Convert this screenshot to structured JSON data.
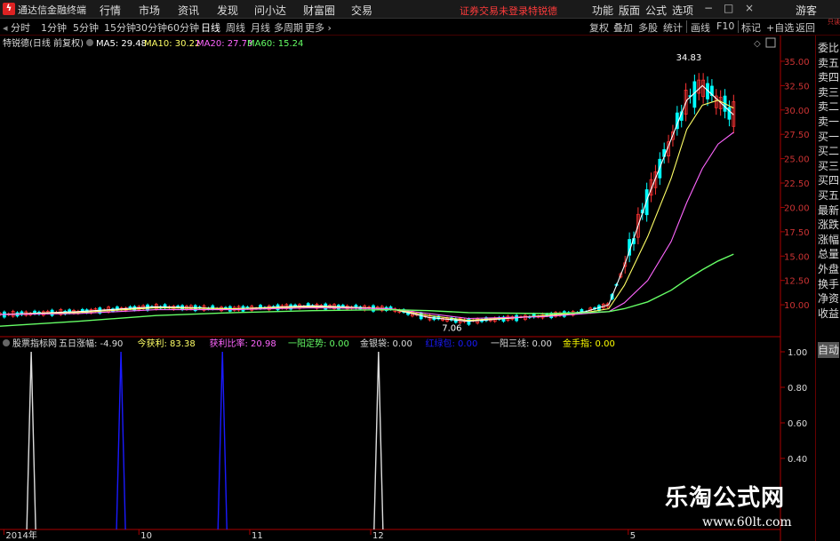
{
  "app": {
    "title": "通达信金融终端",
    "logo": "lightning-logo"
  },
  "menu": [
    "行情",
    "市场",
    "资讯",
    "发现",
    "问小达",
    "财富圈",
    "交易"
  ],
  "notice": "证券交易未登录",
  "stock_name": "特锐德",
  "right_menu": [
    "功能",
    "版面",
    "公式",
    "选项"
  ],
  "window_buttons": [
    "−",
    "□",
    "×"
  ],
  "guest": "游客",
  "periods": [
    "分时",
    "1分钟",
    "5分钟",
    "15分钟",
    "30分钟",
    "60分钟",
    "日线",
    "周线",
    "月线",
    "多周期",
    "更多"
  ],
  "active_period": "日线",
  "toolbar_right": [
    "复权",
    "叠加",
    "多股",
    "统计",
    "画线",
    "F10",
    "标记",
    "+自选",
    "返回"
  ],
  "main_header": {
    "name": "特锐德(日线 前复权)",
    "ma5": "MA5: 29.48",
    "ma10": "MA10: 30.22",
    "ma20": "MA20: 27.73",
    "ma60": "MA60: 15.24"
  },
  "colors": {
    "up": "#ff3333",
    "down": "#00ffff",
    "ma5": "#ffffff",
    "ma10": "#ffff66",
    "ma20": "#ff66ff",
    "ma60": "#66ff66",
    "axis": "#aa0000",
    "ind_white": "#dddddd",
    "ind_blue": "#1a1aff"
  },
  "indicator_header": {
    "name": "股票指标网",
    "items": [
      {
        "label": "五日涨幅: -4.90",
        "color": "#dddddd"
      },
      {
        "label": "今获利: 83.38",
        "color": "#ffff66"
      },
      {
        "label": "获利比率: 20.98",
        "color": "#ff66ff"
      },
      {
        "label": "一阳定势: 0.00",
        "color": "#66ff66"
      },
      {
        "label": "金银袋: 0.00",
        "color": "#dddddd"
      },
      {
        "label": "红绿包: 0.00",
        "color": "#1a1aff"
      },
      {
        "label": "一阳三线: 0.00",
        "color": "#dddddd"
      },
      {
        "label": "金手指: 0.00",
        "color": "#ffff00"
      }
    ]
  },
  "sidebar": [
    "委比",
    "卖五",
    "卖四",
    "卖三",
    "卖二",
    "卖一",
    "买一",
    "买二",
    "买三",
    "买四",
    "买五",
    "最新",
    "涨跌",
    "涨幅",
    "总量",
    "外盘",
    "换手",
    "净资",
    "收益"
  ],
  "auto_label": "自动",
  "rside_badge": "只读",
  "watermark": {
    "line1": "乐淘公式网",
    "line2": "www.60lt.com"
  },
  "chart_data": [
    {
      "type": "candlestick",
      "title": "特锐德(日线 前复权)",
      "ylim": [
        7,
        36
      ],
      "y_ticks": [
        "35.00",
        "32.50",
        "30.00",
        "27.50",
        "25.00",
        "22.50",
        "20.00",
        "17.50",
        "15.00",
        "12.50",
        "10.00"
      ],
      "annotations": [
        {
          "text": "34.83",
          "x": 0.88,
          "y": 34.83
        },
        {
          "text": "7.06",
          "x": 0.58,
          "y": 7.06
        }
      ],
      "x_ticks": [
        "2014年",
        "10",
        "11",
        "12",
        "5"
      ],
      "series": [
        {
          "name": "MA5",
          "x": [
            0,
            0.1,
            0.2,
            0.3,
            0.4,
            0.5,
            0.55,
            0.6,
            0.7,
            0.75,
            0.78,
            0.8,
            0.83,
            0.86,
            0.88,
            0.9,
            0.92,
            0.94
          ],
          "values": [
            9.0,
            9.3,
            9.8,
            9.6,
            9.9,
            9.6,
            8.7,
            8.3,
            8.9,
            9.3,
            10.0,
            14.0,
            21.0,
            27.0,
            31.0,
            32.5,
            31.0,
            29.5
          ]
        },
        {
          "name": "MA10",
          "x": [
            0,
            0.1,
            0.2,
            0.3,
            0.4,
            0.5,
            0.55,
            0.6,
            0.7,
            0.75,
            0.78,
            0.8,
            0.83,
            0.86,
            0.88,
            0.9,
            0.92,
            0.94
          ],
          "values": [
            9.0,
            9.2,
            9.7,
            9.6,
            9.8,
            9.6,
            8.9,
            8.4,
            8.9,
            9.2,
            9.6,
            12.0,
            17.0,
            23.0,
            28.0,
            30.5,
            31.0,
            30.2
          ]
        },
        {
          "name": "MA20",
          "x": [
            0,
            0.1,
            0.2,
            0.3,
            0.4,
            0.5,
            0.55,
            0.6,
            0.7,
            0.75,
            0.78,
            0.8,
            0.83,
            0.86,
            0.88,
            0.9,
            0.92,
            0.94
          ],
          "values": [
            9.0,
            9.1,
            9.5,
            9.5,
            9.7,
            9.6,
            9.1,
            8.6,
            8.8,
            9.1,
            9.3,
            10.2,
            12.5,
            16.5,
            20.5,
            24.0,
            26.5,
            27.7
          ]
        },
        {
          "name": "MA60",
          "x": [
            0,
            0.1,
            0.2,
            0.3,
            0.4,
            0.5,
            0.55,
            0.6,
            0.7,
            0.75,
            0.78,
            0.8,
            0.83,
            0.86,
            0.88,
            0.9,
            0.92,
            0.94
          ],
          "values": [
            7.8,
            8.3,
            8.9,
            9.2,
            9.4,
            9.5,
            9.4,
            9.2,
            9.1,
            9.2,
            9.3,
            9.6,
            10.3,
            11.5,
            12.6,
            13.6,
            14.5,
            15.2
          ]
        }
      ]
    },
    {
      "type": "line",
      "title": "股票指标网",
      "ylim": [
        0,
        1
      ],
      "y_ticks": [
        "1.00",
        "0.80",
        "0.60",
        "0.40"
      ],
      "spikes": [
        {
          "x": 0.04,
          "value": 1.0,
          "color": "white"
        },
        {
          "x": 0.155,
          "value": 1.0,
          "color": "blue"
        },
        {
          "x": 0.285,
          "value": 1.0,
          "color": "blue"
        },
        {
          "x": 0.485,
          "value": 1.0,
          "color": "white"
        }
      ]
    }
  ]
}
